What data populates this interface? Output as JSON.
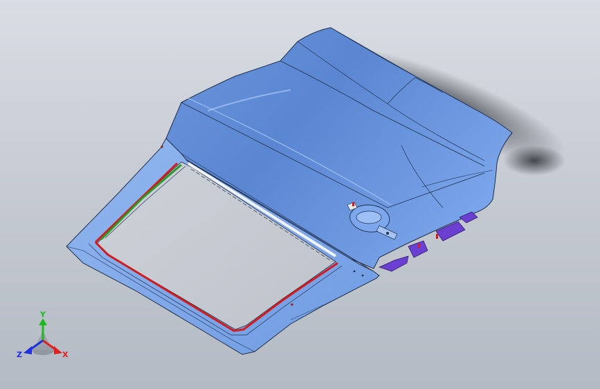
{
  "viewport": {
    "model": "car-door-assembly",
    "colors": {
      "background_top": "#d9dde4",
      "background_bottom": "#b4bac3",
      "panel": "#6f9ee6",
      "panel_light": "#8db4f2",
      "panel_dark": "#4f7dc8",
      "edge": "#1f2e4a",
      "seal_red": "#d21c1c",
      "seal_green": "#2a9a2a",
      "bracket_purple": "#6a3fd1"
    }
  },
  "triad": {
    "x_label": "X",
    "y_label": "Y",
    "z_label": "Z",
    "x_color": "#e0201e",
    "y_color": "#1fb81f",
    "z_color": "#2030e0"
  }
}
